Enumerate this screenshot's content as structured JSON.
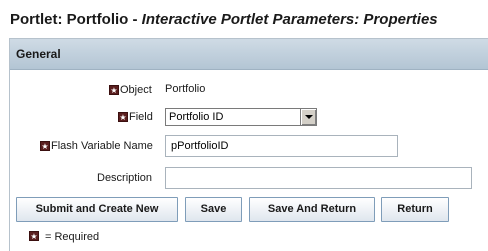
{
  "page": {
    "title": "Portlet: Portfolio",
    "separator": "-",
    "subtitle": "Interactive Portlet Parameters: Properties"
  },
  "section": {
    "title": "General"
  },
  "form": {
    "required_marker": "★",
    "object": {
      "label": "Object",
      "value": "Portfolio"
    },
    "field": {
      "label": "Field",
      "selected": "Portfolio ID"
    },
    "flash_variable": {
      "label": "Flash Variable Name",
      "value": "pPortfolioID"
    },
    "description": {
      "label": "Description",
      "value": ""
    }
  },
  "buttons": {
    "submit_new": "Submit and Create New",
    "save": "Save",
    "save_return": "Save And Return",
    "return": "Return"
  },
  "legend": {
    "text": "= Required"
  }
}
